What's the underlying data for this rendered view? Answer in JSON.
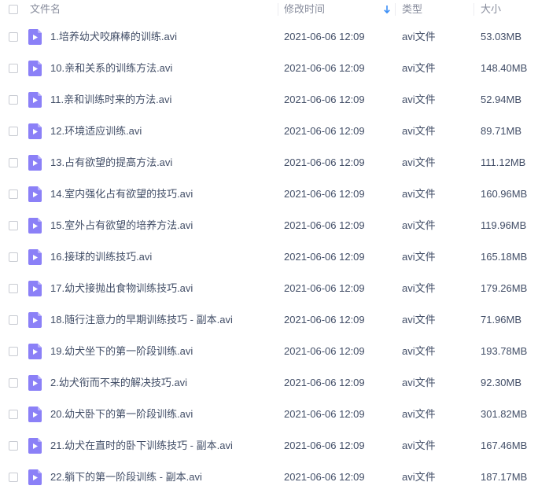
{
  "header": {
    "name_label": "文件名",
    "time_label": "修改时间",
    "type_label": "类型",
    "size_label": "大小",
    "sort_arrow_icon": "arrow-down-icon"
  },
  "file_icon": "video-play-file-icon",
  "colors": {
    "icon_purple": "#8b80f7",
    "header_text": "#878c9c",
    "row_text": "#424e67",
    "sort_arrow": "#3a8ef6"
  },
  "files": [
    {
      "name": "1.培养幼犬咬麻棒的训练.avi",
      "modified": "2021-06-06 12:09",
      "type": "avi文件",
      "size": "53.03MB"
    },
    {
      "name": "10.亲和关系的训练方法.avi",
      "modified": "2021-06-06 12:09",
      "type": "avi文件",
      "size": "148.40MB"
    },
    {
      "name": "11.亲和训练时来的方法.avi",
      "modified": "2021-06-06 12:09",
      "type": "avi文件",
      "size": "52.94MB"
    },
    {
      "name": "12.环境适应训练.avi",
      "modified": "2021-06-06 12:09",
      "type": "avi文件",
      "size": "89.71MB"
    },
    {
      "name": "13.占有欲望的提高方法.avi",
      "modified": "2021-06-06 12:09",
      "type": "avi文件",
      "size": "111.12MB"
    },
    {
      "name": "14.室内强化占有欲望的技巧.avi",
      "modified": "2021-06-06 12:09",
      "type": "avi文件",
      "size": "160.96MB"
    },
    {
      "name": "15.室外占有欲望的培养方法.avi",
      "modified": "2021-06-06 12:09",
      "type": "avi文件",
      "size": "119.96MB"
    },
    {
      "name": "16.接球的训练技巧.avi",
      "modified": "2021-06-06 12:09",
      "type": "avi文件",
      "size": "165.18MB"
    },
    {
      "name": "17.幼犬接抛出食物训练技巧.avi",
      "modified": "2021-06-06 12:09",
      "type": "avi文件",
      "size": "179.26MB"
    },
    {
      "name": "18.随行注意力的早期训练技巧 - 副本.avi",
      "modified": "2021-06-06 12:09",
      "type": "avi文件",
      "size": "71.96MB"
    },
    {
      "name": "19.幼犬坐下的第一阶段训练.avi",
      "modified": "2021-06-06 12:09",
      "type": "avi文件",
      "size": "193.78MB"
    },
    {
      "name": "2.幼犬衔而不来的解决技巧.avi",
      "modified": "2021-06-06 12:09",
      "type": "avi文件",
      "size": "92.30MB"
    },
    {
      "name": "20.幼犬卧下的第一阶段训练.avi",
      "modified": "2021-06-06 12:09",
      "type": "avi文件",
      "size": "301.82MB"
    },
    {
      "name": "21.幼犬在直时的卧下训练技巧 - 副本.avi",
      "modified": "2021-06-06 12:09",
      "type": "avi文件",
      "size": "167.46MB"
    },
    {
      "name": "22.躺下的第一阶段训练 - 副本.avi",
      "modified": "2021-06-06 12:09",
      "type": "avi文件",
      "size": "187.17MB"
    }
  ]
}
